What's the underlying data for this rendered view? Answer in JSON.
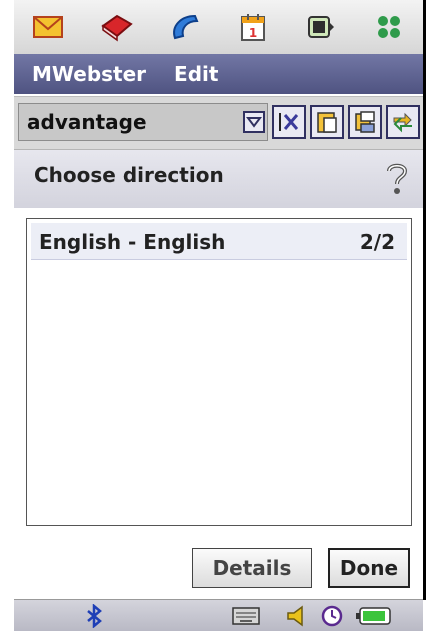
{
  "menubar": {
    "items": [
      {
        "label": "MWebster"
      },
      {
        "label": "Edit"
      }
    ]
  },
  "toolbar": {
    "search_value": "advantage"
  },
  "dialog": {
    "title": "Choose direction",
    "list": [
      {
        "name": "English - English",
        "count": "2/2"
      }
    ]
  },
  "buttons": {
    "details_label": "Details",
    "done_label": "Done"
  },
  "icons": {
    "top": [
      "mail-icon",
      "dictionary-book-icon",
      "phone-icon",
      "calendar-icon",
      "media-icon",
      "apps-grid-icon"
    ],
    "toolbar": [
      "dropdown-icon",
      "clear-text-icon",
      "paste-icon",
      "copy-icon",
      "swap-icon"
    ],
    "status": [
      "bluetooth-icon",
      "keyboard-icon",
      "volume-icon",
      "clock-icon",
      "battery-icon"
    ]
  },
  "colors": {
    "menubar": "#5b5f8e",
    "selection": "#eceef6",
    "accent": "#3b3b8f"
  }
}
